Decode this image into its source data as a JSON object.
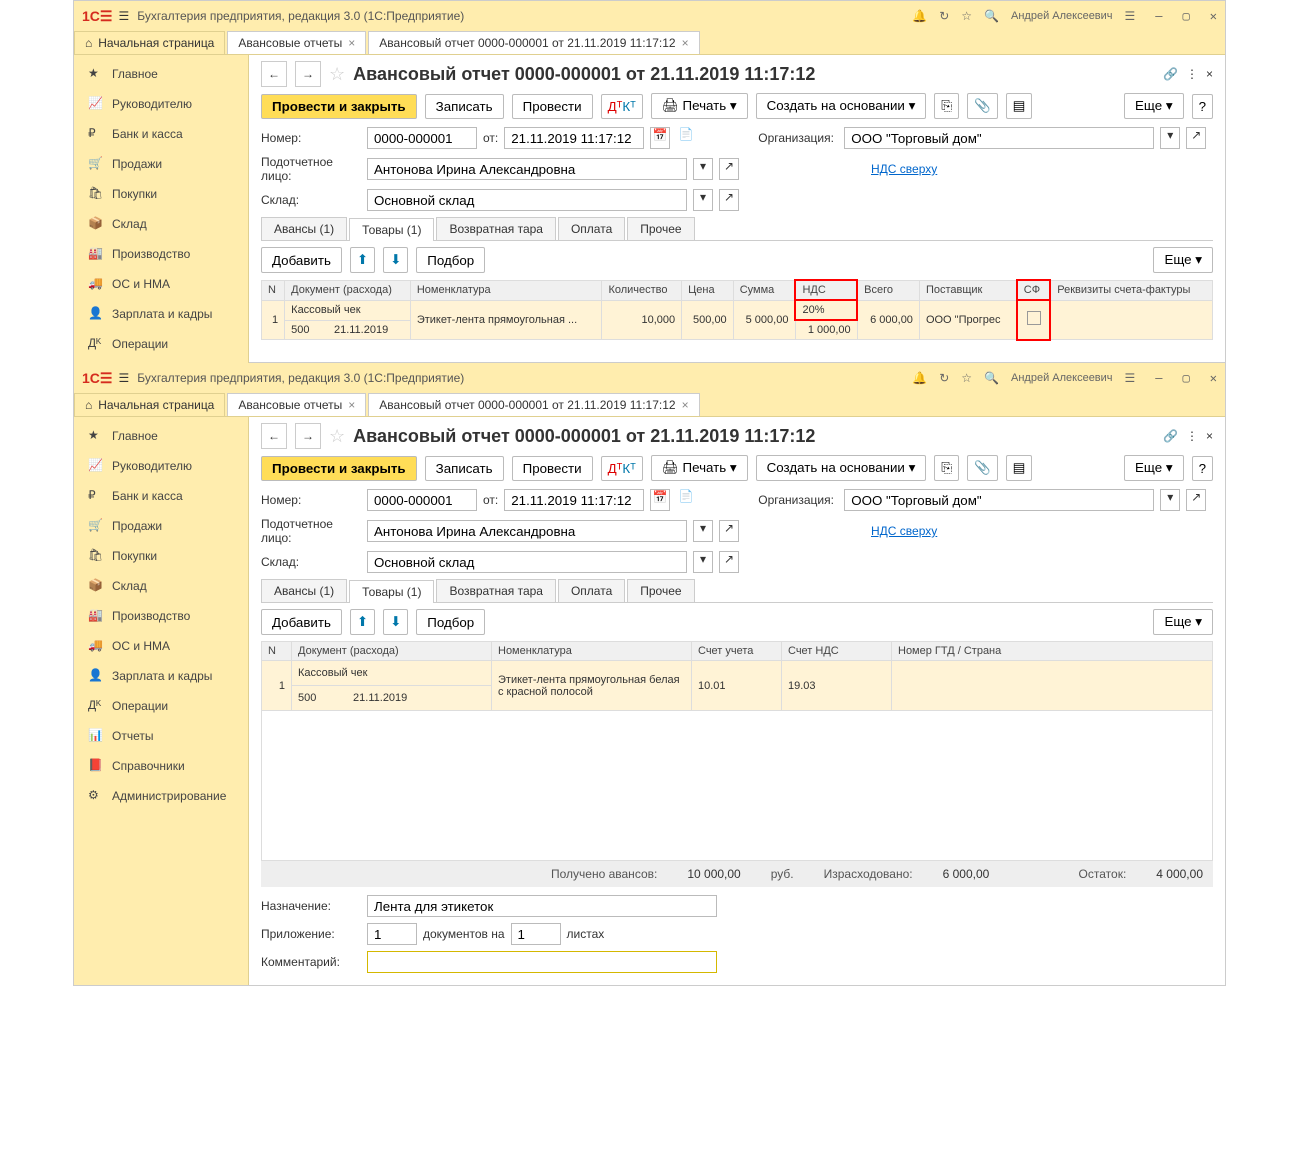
{
  "app_title": "Бухгалтерия предприятия, редакция 3.0  (1С:Предприятие)",
  "user": "Андрей Алексеевич",
  "tabs": {
    "home": "Начальная страница",
    "t1": "Авансовые отчеты",
    "t2": "Авансовый отчет 0000-000001 от 21.11.2019 11:17:12"
  },
  "sidebar": {
    "main": "Главное",
    "manager": "Руководителю",
    "bank": "Банк и касса",
    "sales": "Продажи",
    "purchase": "Покупки",
    "stock": "Склад",
    "production": "Производство",
    "os": "ОС и НМА",
    "salary": "Зарплата и кадры",
    "ops": "Операции",
    "reports": "Отчеты",
    "refs": "Справочники",
    "admin": "Администрирование"
  },
  "doc": {
    "title": "Авансовый отчет 0000-000001 от 21.11.2019 11:17:12",
    "post_close": "Провести и закрыть",
    "save": "Записать",
    "post": "Провести",
    "print": "Печать",
    "create_based": "Создать на основании",
    "more": "Еще",
    "number_lbl": "Номер:",
    "number": "0000-000001",
    "from_lbl": "от:",
    "date": "21.11.2019 11:17:12",
    "org_lbl": "Организация:",
    "org": "ООО \"Торговый дом\"",
    "person_lbl": "Подотчетное лицо:",
    "person": "Антонова Ирина Александровна",
    "vat_link": "НДС сверху",
    "warehouse_lbl": "Склад:",
    "warehouse": "Основной склад",
    "tab_advances": "Авансы (1)",
    "tab_goods": "Товары (1)",
    "tab_tare": "Возвратная тара",
    "tab_pay": "Оплата",
    "tab_other": "Прочее",
    "add": "Добавить",
    "select": "Подбор"
  },
  "table1": {
    "cols": {
      "n": "N",
      "doc": "Документ (расхода)",
      "nom": "Номенклатура",
      "qty": "Количество",
      "price": "Цена",
      "sum": "Сумма",
      "vat": "НДС",
      "total": "Всего",
      "supplier": "Поставщик",
      "sf": "СФ",
      "sf_req": "Реквизиты счета-фактуры"
    },
    "row": {
      "n": "1",
      "doc1": "Кассовый чек",
      "doc2a": "500",
      "doc2b": "21.11.2019",
      "nom": "Этикет-лента прямоугольная ...",
      "qty": "10,000",
      "price": "500,00",
      "sum": "5 000,00",
      "vat": "20%",
      "vat_sum": "1 000,00",
      "total": "6 000,00",
      "supplier": "ООО \"Прогрес"
    }
  },
  "table2": {
    "cols": {
      "n": "N",
      "doc": "Документ (расхода)",
      "nom": "Номенклатура",
      "acc": "Счет учета",
      "vat_acc": "Счет НДС",
      "gtd": "Номер ГТД / Страна"
    },
    "row": {
      "n": "1",
      "doc1": "Кассовый чек",
      "doc2a": "500",
      "doc2b": "21.11.2019",
      "nom": "Этикет-лента прямоугольная белая с красной полосой",
      "acc": "10.01",
      "vat_acc": "19.03"
    }
  },
  "summary": {
    "received_lbl": "Получено авансов:",
    "received": "10 000,00",
    "rub": "руб.",
    "spent_lbl": "Израсходовано:",
    "spent": "6 000,00",
    "rest_lbl": "Остаток:",
    "rest": "4 000,00"
  },
  "footer": {
    "purpose_lbl": "Назначение:",
    "purpose": "Лента для этикеток",
    "attach_lbl": "Приложение:",
    "attach_n1": "1",
    "attach_docs": "документов на",
    "attach_n2": "1",
    "attach_sheets": "листах",
    "comment_lbl": "Комментарий:"
  }
}
